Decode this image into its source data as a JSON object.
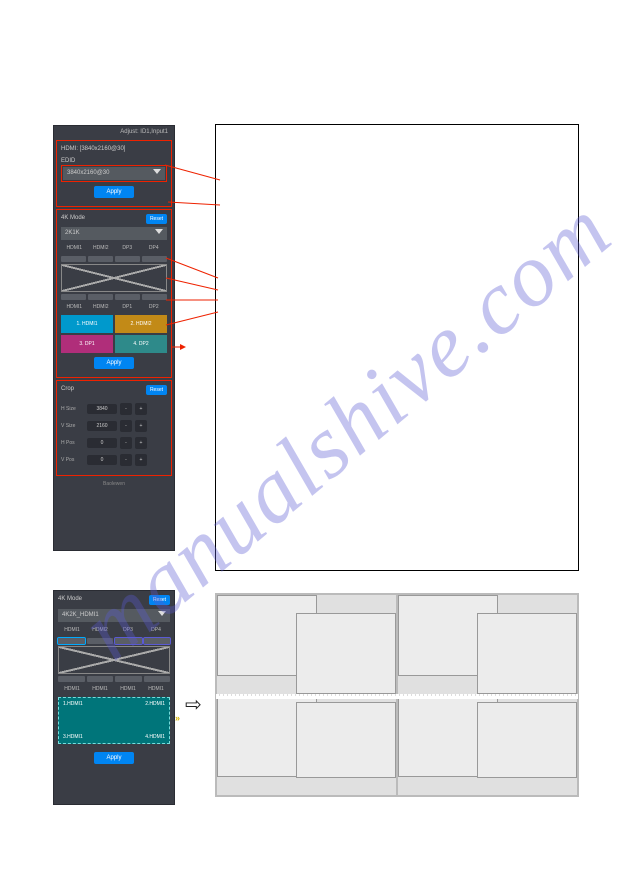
{
  "watermark": "manualshive.com",
  "panelA": {
    "header": "Adjust: ID1,Input1",
    "hdmi_label": "HDMI: [3840x2160@30]",
    "edid_label": "EDID",
    "edid_value": "3840x2160@30",
    "apply1": "Apply",
    "mode_title": "4K Mode",
    "reset1": "Reset",
    "mode_value": "2K1K",
    "ports_top": [
      "HDMI1",
      "HDMI2",
      "DP3",
      "DP4"
    ],
    "ports_bot": [
      "HDMI1",
      "HDMI2",
      "DP1",
      "DP2"
    ],
    "src": {
      "a": "1. HDMI1",
      "b": "2. HDMI2",
      "c": "3. DP1",
      "d": "4. DP2"
    },
    "apply2": "Apply",
    "crop_title": "Crop",
    "reset2": "Reset",
    "rows": [
      {
        "label": "H Size",
        "value": "3840"
      },
      {
        "label": "V Size",
        "value": "2160"
      },
      {
        "label": "H Pos",
        "value": "0"
      },
      {
        "label": "V Pos",
        "value": "0"
      }
    ],
    "footer": "Baolewen"
  },
  "panelB": {
    "mode_title": "4K Mode",
    "reset": "Reset",
    "mode_value": "4K2K_HDMI1",
    "ports_top": [
      "HDMI1",
      "HDMI2",
      "DP3",
      "DP4"
    ],
    "ports_bot": [
      "HDMI1",
      "HDMI1",
      "HDMI1",
      "HDMI1"
    ],
    "quad": {
      "a": "1.HDMI1",
      "b": "2.HDMI1",
      "c": "3.HDMI1",
      "d": "4.HDMI1"
    },
    "apply": "Apply"
  }
}
